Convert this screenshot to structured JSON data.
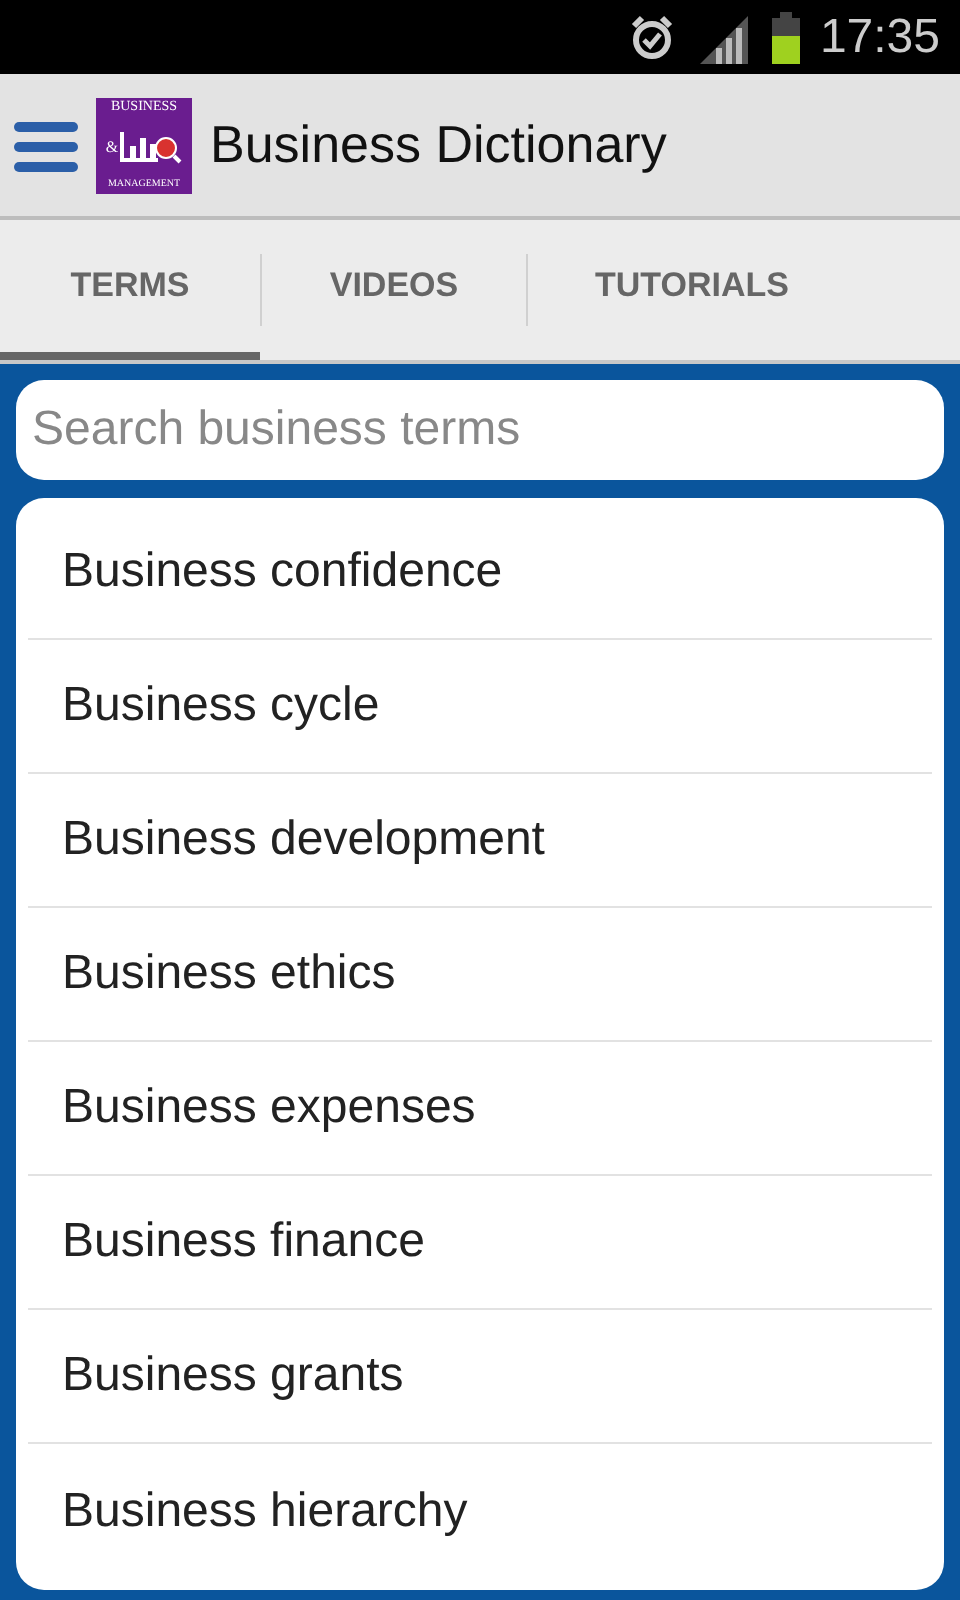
{
  "status_bar": {
    "time": "17:35"
  },
  "action_bar": {
    "title": "Business Dictionary",
    "logo": {
      "top": "BUSINESS",
      "mark": "&",
      "bottom": "MANAGEMENT"
    }
  },
  "tabs": [
    {
      "label": "TERMS",
      "selected": true
    },
    {
      "label": "VIDEOS",
      "selected": false
    },
    {
      "label": "TUTORIALS",
      "selected": false
    }
  ],
  "search": {
    "placeholder": "Search business terms"
  },
  "terms": [
    "Business confidence",
    "Business cycle",
    "Business development",
    "Business ethics",
    "Business expenses",
    "Business finance",
    "Business grants",
    "Business hierarchy"
  ]
}
